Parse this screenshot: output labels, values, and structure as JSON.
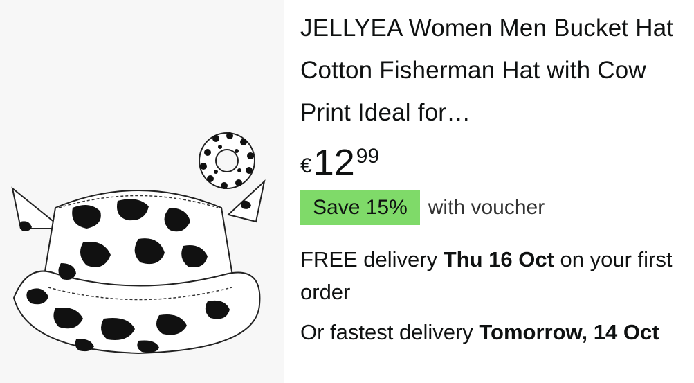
{
  "product": {
    "title": "JELLYEA Women Men Bucket Hat Cotton Fisherman Hat with Cow Print Ideal for…",
    "image_alt": "cow-print bucket hat with horns and scrunchie",
    "price": {
      "symbol": "€",
      "whole": "12",
      "fraction": "99"
    },
    "voucher": {
      "badge": "Save 15%",
      "text": "with voucher"
    },
    "delivery": {
      "prefix": "FREE delivery ",
      "date": "Thu 16 Oct",
      "suffix": " on your first order"
    },
    "fastest": {
      "prefix": "Or fastest delivery ",
      "date": "Tomorrow, 14 Oct"
    }
  },
  "colors": {
    "voucher_bg": "#7fda69",
    "image_bg": "#f7f7f7",
    "text": "#0f1111"
  }
}
